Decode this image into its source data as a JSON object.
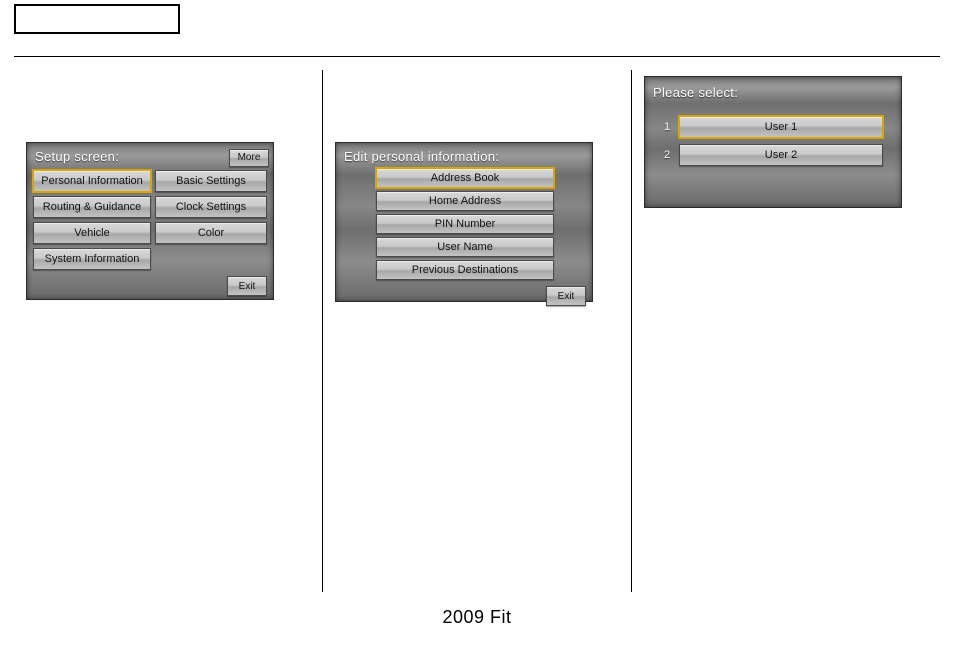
{
  "footer": "2009  Fit",
  "panel1": {
    "title": "Setup screen:",
    "more": "More",
    "exit": "Exit",
    "buttons": {
      "personal_info": "Personal Information",
      "basic_settings": "Basic Settings",
      "routing": "Routing & Guidance",
      "clock": "Clock Settings",
      "vehicle": "Vehicle",
      "color": "Color",
      "system_info": "System Information"
    }
  },
  "panel2": {
    "title": "Edit personal information:",
    "exit": "Exit",
    "buttons": {
      "address_book": "Address Book",
      "home_address": "Home Address",
      "pin": "PIN Number",
      "user_name": "User Name",
      "prev_dest": "Previous Destinations"
    }
  },
  "panel3": {
    "title": "Please select:",
    "rows": [
      {
        "num": "1",
        "label": "User 1"
      },
      {
        "num": "2",
        "label": "User 2"
      }
    ]
  }
}
